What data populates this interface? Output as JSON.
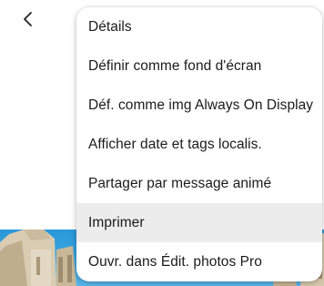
{
  "header": {
    "back_icon": "chevron-left-icon"
  },
  "menu": {
    "items": [
      {
        "label": "Détails"
      },
      {
        "label": "Définir comme fond d'écran"
      },
      {
        "label": "Déf. comme img Always On Display"
      },
      {
        "label": "Afficher date et tags localis."
      },
      {
        "label": "Partager par message animé"
      },
      {
        "label": "Imprimer",
        "highlighted": true
      },
      {
        "label": "Ouvr. dans Édit. photos Pro"
      }
    ]
  },
  "colors": {
    "menu_background": "#ffffff",
    "highlight": "#ececec",
    "text": "#1b1b1b",
    "photo_sky": "#3ba6e2"
  }
}
